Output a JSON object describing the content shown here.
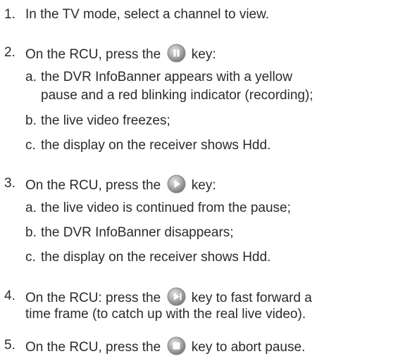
{
  "steps": [
    {
      "number": "1.",
      "text": "In the TV mode, select a channel to view."
    },
    {
      "number": "2.",
      "before": "On the RCU, press the",
      "icon": "pause-key-icon",
      "after": "key:",
      "subs": [
        {
          "letter": "a.",
          "lines": [
            "the DVR InfoBanner appears with a yellow",
            "pause and a red blinking indicator (recording);"
          ]
        },
        {
          "letter": "b.",
          "lines": [
            "the live video freezes;"
          ]
        },
        {
          "letter": "c.",
          "lines": [
            "the display on the receiver shows Hdd."
          ]
        }
      ]
    },
    {
      "number": "3.",
      "before": "On the RCU, press the",
      "icon": "play-key-icon",
      "after": "key:",
      "subs": [
        {
          "letter": "a.",
          "lines": [
            "the live video is continued from the pause;"
          ]
        },
        {
          "letter": "b.",
          "lines": [
            "the DVR InfoBanner disappears;"
          ]
        },
        {
          "letter": "c.",
          "lines": [
            "the display on the receiver shows Hdd."
          ]
        }
      ]
    },
    {
      "number": "4.",
      "before": "On the RCU: press the",
      "icon": "fast-forward-key-icon",
      "after": "key to fast forward a",
      "line2": "time frame (to catch up with the real live video)."
    },
    {
      "number": "5.",
      "before": "On the RCU, press the",
      "icon": "stop-key-icon",
      "after": "key to abort pause."
    }
  ],
  "colors": {
    "text": "#2b2b2b",
    "key_fill_light": "#dcdcdc",
    "key_fill_dark": "#8a8a8a"
  }
}
